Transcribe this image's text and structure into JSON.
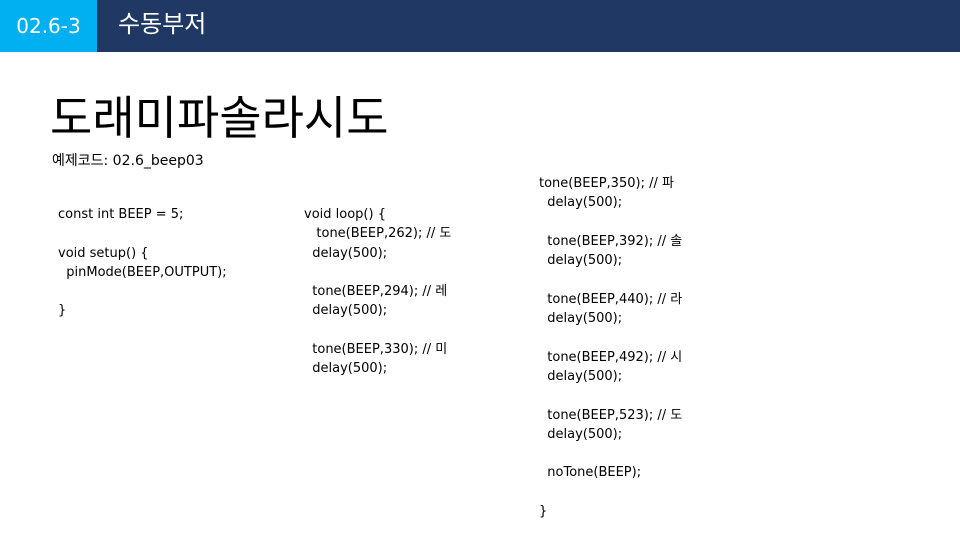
{
  "header": {
    "section_number": "02.6-3",
    "section_title": "수동부저",
    "colors": {
      "bar": "#1f3864",
      "badge": "#00b0f0"
    }
  },
  "slide": {
    "title": "도래미파솔라시도",
    "example_caption": "예제코드: 02.6_beep03"
  },
  "code": {
    "column_1": "const int BEEP = 5;\n\nvoid setup() {\n  pinMode(BEEP,OUTPUT);\n\n}",
    "column_2": "void loop() {\n   tone(BEEP,262); // 도\n  delay(500);\n\n  tone(BEEP,294); // 레\n  delay(500);\n\n  tone(BEEP,330); // 미\n  delay(500);",
    "column_3": "tone(BEEP,350); // 파\n  delay(500);\n\n  tone(BEEP,392); // 솔\n  delay(500);\n\n  tone(BEEP,440); // 라\n  delay(500);\n\n  tone(BEEP,492); // 시\n  delay(500);\n\n  tone(BEEP,523); // 도\n  delay(500);\n\n  noTone(BEEP);\n\n}"
  }
}
